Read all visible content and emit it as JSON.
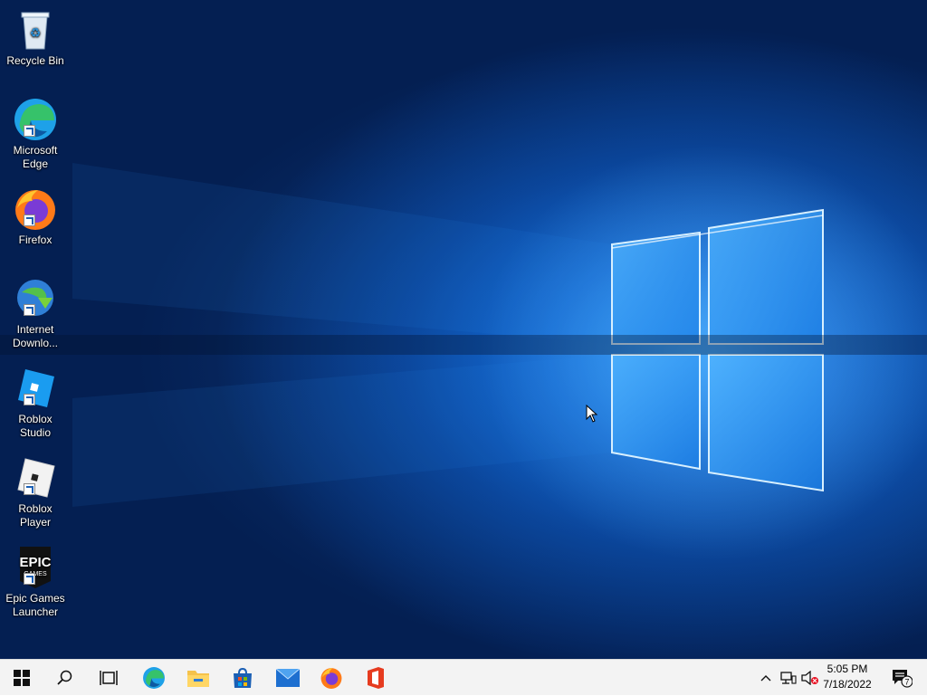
{
  "desktop": {
    "icons": [
      {
        "label": "Recycle Bin",
        "icon": "recycle-bin-icon"
      },
      {
        "label": "Microsoft\nEdge",
        "icon": "edge-icon"
      },
      {
        "label": "Firefox",
        "icon": "firefox-icon"
      },
      {
        "label": "Internet\nDownlo...",
        "icon": "internet-download-manager-icon"
      },
      {
        "label": "Roblox Studio",
        "icon": "roblox-studio-icon"
      },
      {
        "label": "Roblox Player",
        "icon": "roblox-player-icon"
      },
      {
        "label": "Epic Games\nLauncher",
        "icon": "epic-games-icon",
        "logo_text": "EPIC GAMES"
      }
    ]
  },
  "taskbar": {
    "items": [
      {
        "name": "start",
        "icon": "windows-logo-icon"
      },
      {
        "name": "search",
        "icon": "search-icon"
      },
      {
        "name": "task-view",
        "icon": "task-view-icon"
      },
      {
        "name": "edge",
        "icon": "edge-icon"
      },
      {
        "name": "file-explorer",
        "icon": "folder-icon"
      },
      {
        "name": "store",
        "icon": "store-icon"
      },
      {
        "name": "mail",
        "icon": "mail-icon"
      },
      {
        "name": "firefox",
        "icon": "firefox-icon"
      },
      {
        "name": "office",
        "icon": "office-icon"
      }
    ],
    "tray": {
      "time": "5:05 PM",
      "date": "7/18/2022",
      "notification_count": "7"
    }
  },
  "colors": {
    "accent": "#0078d7",
    "taskbar_bg": "#f3f3f3"
  }
}
